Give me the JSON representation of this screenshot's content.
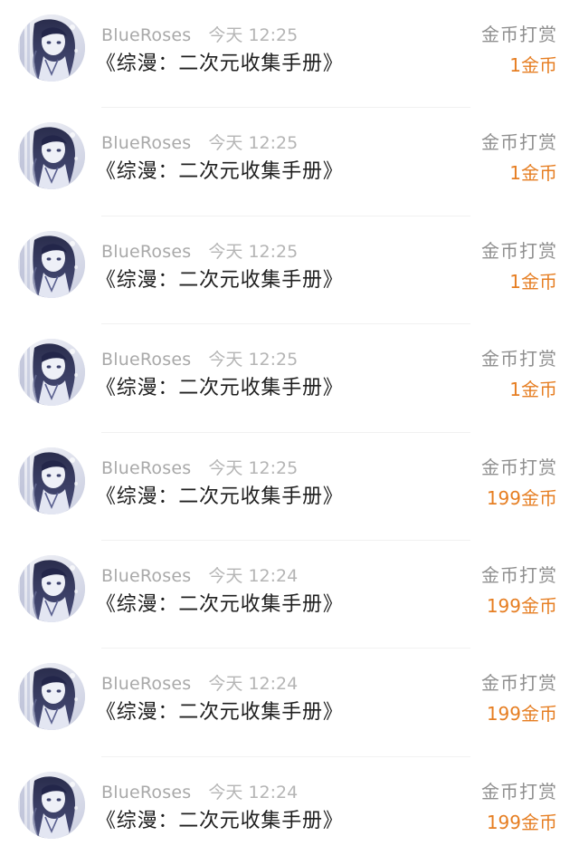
{
  "colors": {
    "amount": "#e67e22",
    "username": "#a9a9a9",
    "title": "#1f1f1f",
    "label": "#8f8f8f"
  },
  "records": [
    {
      "user": "BlueRoses",
      "time": "今天 12:25",
      "title": "《综漫：二次元收集手册》",
      "type": "金币打赏",
      "amount": "1金币",
      "avatar": "avatar-image"
    },
    {
      "user": "BlueRoses",
      "time": "今天 12:25",
      "title": "《综漫：二次元收集手册》",
      "type": "金币打赏",
      "amount": "1金币",
      "avatar": "avatar-image"
    },
    {
      "user": "BlueRoses",
      "time": "今天 12:25",
      "title": "《综漫：二次元收集手册》",
      "type": "金币打赏",
      "amount": "1金币",
      "avatar": "avatar-image"
    },
    {
      "user": "BlueRoses",
      "time": "今天 12:25",
      "title": "《综漫：二次元收集手册》",
      "type": "金币打赏",
      "amount": "1金币",
      "avatar": "avatar-image"
    },
    {
      "user": "BlueRoses",
      "time": "今天 12:25",
      "title": "《综漫：二次元收集手册》",
      "type": "金币打赏",
      "amount": "199金币",
      "avatar": "avatar-image"
    },
    {
      "user": "BlueRoses",
      "time": "今天 12:24",
      "title": "《综漫：二次元收集手册》",
      "type": "金币打赏",
      "amount": "199金币",
      "avatar": "avatar-image"
    },
    {
      "user": "BlueRoses",
      "time": "今天 12:24",
      "title": "《综漫：二次元收集手册》",
      "type": "金币打赏",
      "amount": "199金币",
      "avatar": "avatar-image"
    },
    {
      "user": "BlueRoses",
      "time": "今天 12:24",
      "title": "《综漫：二次元收集手册》",
      "type": "金币打赏",
      "amount": "199金币",
      "avatar": "avatar-image"
    }
  ]
}
